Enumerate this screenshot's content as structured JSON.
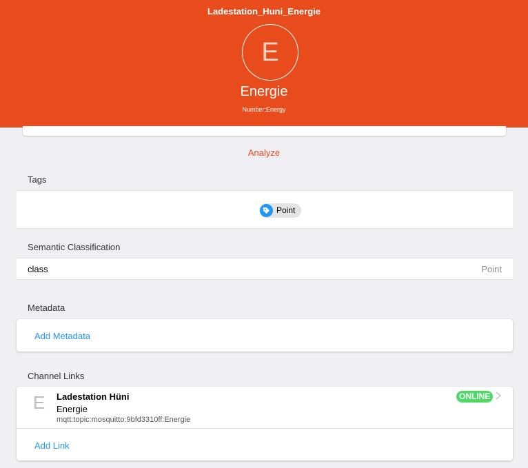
{
  "header": {
    "page_title": "Ladestation_Huni_Energie",
    "avatar_letter": "E",
    "item_label": "Energie",
    "item_type": "Number:Energy"
  },
  "actions": {
    "analyze_label": "Analyze"
  },
  "tags": {
    "title": "Tags",
    "items": [
      {
        "label": "Point",
        "icon": "tag-icon"
      }
    ]
  },
  "semantic": {
    "title": "Semantic Classification",
    "rows": [
      {
        "key": "class",
        "value": "Point"
      }
    ]
  },
  "metadata": {
    "title": "Metadata",
    "add_label": "Add Metadata"
  },
  "channel_links": {
    "title": "Channel Links",
    "items": [
      {
        "icon_letter": "E",
        "thing_label": "Ladestation Hüni",
        "channel_label": "Energie",
        "channel_uid": "mqtt:topic:mosquitto:9bfd3310ff:Energie",
        "status": "ONLINE"
      }
    ],
    "add_label": "Add Link"
  },
  "colors": {
    "accent": "#e84c1c",
    "link": "#2196f3",
    "online": "#4cd964"
  }
}
